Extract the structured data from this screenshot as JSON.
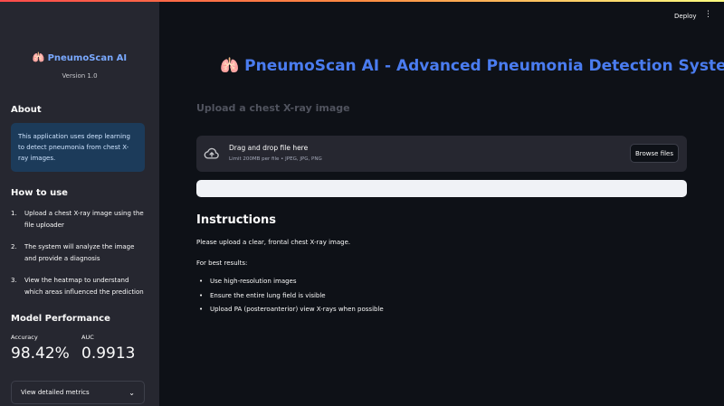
{
  "sidebar": {
    "brand": "PneumoScan AI",
    "brand_icon": "lungs-icon",
    "version": "Version 1.0",
    "about_heading": "About",
    "about_text": "This application uses deep learning to detect pneumonia from chest X-ray images.",
    "howto_heading": "How to use",
    "howto_steps": [
      {
        "num": "1.",
        "text": "Upload a chest X-ray image using the file uploader"
      },
      {
        "num": "2.",
        "text": "The system will analyze the image and provide a diagnosis"
      },
      {
        "num": "3.",
        "text": "View the heatmap to understand which areas influenced the prediction"
      }
    ],
    "performance_heading": "Model Performance",
    "metrics": [
      {
        "label": "Accuracy",
        "value": "98.42%"
      },
      {
        "label": "AUC",
        "value": "0.9913"
      }
    ],
    "expander_label": "View detailed metrics"
  },
  "header": {
    "deploy_label": "Deploy",
    "menu_icon": "⋮"
  },
  "main": {
    "title": "PneumoScan AI - Advanced Pneumonia Detection System",
    "title_icon": "🫁",
    "upload_heading": "Upload a chest X-ray image",
    "dropzone": {
      "title": "Drag and drop file here",
      "subtitle": "Limit 200MB per file • JPEG, JPG, PNG",
      "button": "Browse files"
    },
    "instructions_heading": "Instructions",
    "instructions_intro": "Please upload a clear, frontal chest X-ray image.",
    "best_results_label": "For best results:",
    "bullets": [
      "Use high-resolution images",
      "Ensure the entire lung field is visible",
      "Upload PA (posteroanterior) view X-rays when possible"
    ]
  },
  "colors": {
    "accent_blue": "#4a7cf0",
    "sidebar_bg": "#262730",
    "main_bg": "#0e1117",
    "info_bg": "#1c3b5a"
  }
}
